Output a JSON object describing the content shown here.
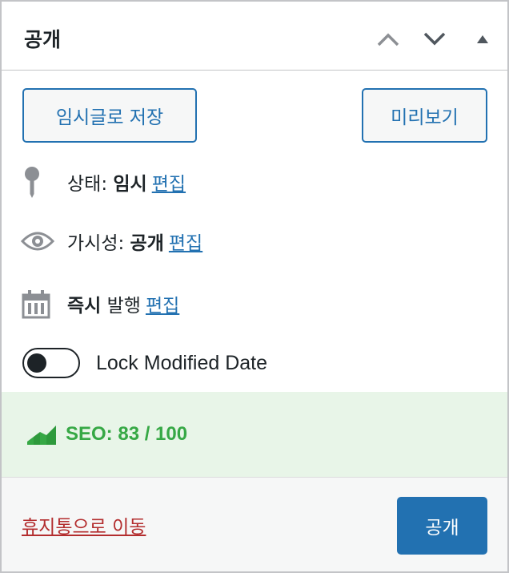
{
  "header": {
    "title": "공개",
    "move_up_icon": "chevron-up-icon",
    "move_down_icon": "chevron-down-icon",
    "toggle_icon": "triangle-up-icon"
  },
  "actions": {
    "save_draft_label": "임시글로 저장",
    "preview_label": "미리보기"
  },
  "status": {
    "label": "상태:",
    "value": "임시",
    "edit_label": "편집",
    "icon": "pin-icon"
  },
  "visibility": {
    "label": "가시성:",
    "value": "공개",
    "edit_label": "편집",
    "icon": "eye-icon"
  },
  "schedule": {
    "value": "즉시",
    "label": "발행",
    "edit_label": "편집",
    "icon": "calendar-icon"
  },
  "lock_modified": {
    "label": "Lock Modified Date",
    "enabled": false
  },
  "seo": {
    "text": "SEO: 83 / 100",
    "color": "#36a845",
    "icon": "seo-chart-icon"
  },
  "footer": {
    "trash_label": "휴지통으로 이동",
    "publish_label": "공개"
  },
  "colors": {
    "accent": "#2271b1",
    "danger": "#b32d2e",
    "seo_bg": "#e8f5e8"
  }
}
